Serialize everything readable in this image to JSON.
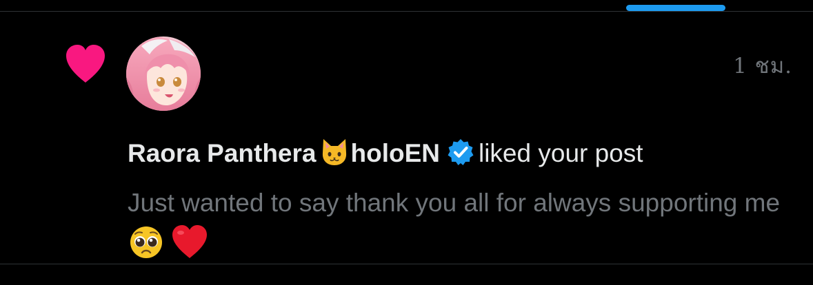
{
  "tabs": {
    "active_indicator_color": "#1d9bf0"
  },
  "notification": {
    "type": "like",
    "heart_color": "#f91880",
    "avatar_description": "avatar",
    "user": {
      "display_name": "Raora Panthera",
      "name_emoji": "cat-face",
      "affiliation": "holoEN",
      "verified": true
    },
    "action": "liked your post",
    "timestamp": "1 ชม.",
    "post_text": "Just wanted to say thank you all for always supporting me",
    "post_emojis": [
      "pleading-face",
      "red-heart"
    ]
  },
  "colors": {
    "background": "#000000",
    "primary_text": "#e7e9ea",
    "secondary_text": "#71767b",
    "verified_blue": "#1d9bf0",
    "divider": "#2f3336"
  }
}
